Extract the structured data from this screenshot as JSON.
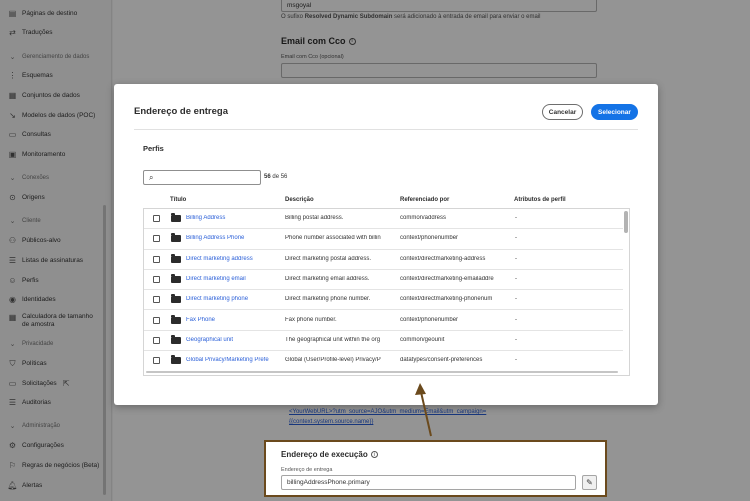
{
  "sidebar": {
    "items": [
      {
        "label": "Páginas de destino",
        "icon": "page-icon"
      },
      {
        "label": "Traduções",
        "icon": "translate-icon"
      },
      {
        "label": "Esquemas",
        "icon": "schema-icon"
      },
      {
        "label": "Conjuntos de dados",
        "icon": "dataset-icon"
      },
      {
        "label": "Modelos de dados (POC)",
        "icon": "data-model-icon"
      },
      {
        "label": "Consultas",
        "icon": "query-icon"
      },
      {
        "label": "Monitoramento",
        "icon": "monitor-icon"
      },
      {
        "label": "Origens",
        "icon": "source-icon"
      },
      {
        "label": "Públicos-alvo",
        "icon": "audience-icon"
      },
      {
        "label": "Listas de assinaturas",
        "icon": "subscription-icon"
      },
      {
        "label": "Perfis",
        "icon": "profile-icon"
      },
      {
        "label": "Identidades",
        "icon": "identity-icon"
      },
      {
        "label": "Calculadora de tamanho de amostra",
        "icon": "calculator-icon"
      },
      {
        "label": "Políticas",
        "icon": "policy-icon"
      },
      {
        "label": "Solicitações",
        "icon": "request-icon"
      },
      {
        "label": "Auditorias",
        "icon": "audit-icon"
      },
      {
        "label": "Configurações",
        "icon": "settings-icon"
      },
      {
        "label": "Regras de negócios (Beta)",
        "icon": "rules-icon"
      },
      {
        "label": "Alertas",
        "icon": "alert-icon"
      }
    ],
    "sections": {
      "data": "Gerenciamento de dados",
      "connections": "Conexões",
      "client": "Cliente",
      "privacy": "Privacidade",
      "admin": "Administração"
    }
  },
  "background": {
    "top_input_value": "msgoyal",
    "subdomain_help_pre": "O sufixo ",
    "subdomain_help_bold": "Resolved Dynamic Subdomain",
    "subdomain_help_post": " será adicionado à entrada de email para enviar o email",
    "bcc_heading": "Email com Cco",
    "bcc_label": "Email com Cco (opcional)",
    "link_text_1": "<YourWebURL>?utm_source=AJO&utm_medium=Email&utm_campaign=",
    "link_text_2": "{{context.system.source.name}}"
  },
  "modal": {
    "title": "Endereço de entrega",
    "cancel_label": "Cancelar",
    "select_label": "Selecionar",
    "section_label": "Perfis",
    "search_placeholder": "",
    "count_shown": "56",
    "count_sep": " de ",
    "count_total": "56",
    "columns": {
      "title": "Título",
      "description": "Descrição",
      "referenced_by": "Referenciado por",
      "profile_attributes": "Atributos de perfil"
    },
    "rows": [
      {
        "title": "Billing Address",
        "description": "Billing postal address.",
        "referenced_by": "common/address",
        "attrs": "-"
      },
      {
        "title": "Billing Address Phone",
        "description": "Phone number associated with billin",
        "referenced_by": "context/phonenumber",
        "attrs": "-"
      },
      {
        "title": "Direct marketing address",
        "description": "Direct marketing postal address.",
        "referenced_by": "context/directmarketing-address",
        "attrs": "-"
      },
      {
        "title": "Direct marketing email",
        "description": "Direct marketing email address.",
        "referenced_by": "context/directmarketing-emailaddre",
        "attrs": "-"
      },
      {
        "title": "Direct marketing phone",
        "description": "Direct marketing phone number.",
        "referenced_by": "context/directmarketing-phonenum",
        "attrs": "-"
      },
      {
        "title": "Fax Phone",
        "description": "Fax phone number.",
        "referenced_by": "context/phonenumber",
        "attrs": "-"
      },
      {
        "title": "Geographical unit",
        "description": "The geographical unit within the org",
        "referenced_by": "common/geounit",
        "attrs": "-"
      },
      {
        "title": "Global Privacy/Marketing Prefe",
        "description": "Global (User/Profile-level) Privacy/P",
        "referenced_by": "datatypes/consent-preferences",
        "attrs": "-"
      }
    ]
  },
  "execution": {
    "heading": "Endereço de execução",
    "label": "Endereço de entrega",
    "value": "billingAddressPhone.primary"
  },
  "colors": {
    "accent": "#1473e6",
    "link": "#2a5fd8",
    "highlight_border": "#6b4a1d"
  }
}
